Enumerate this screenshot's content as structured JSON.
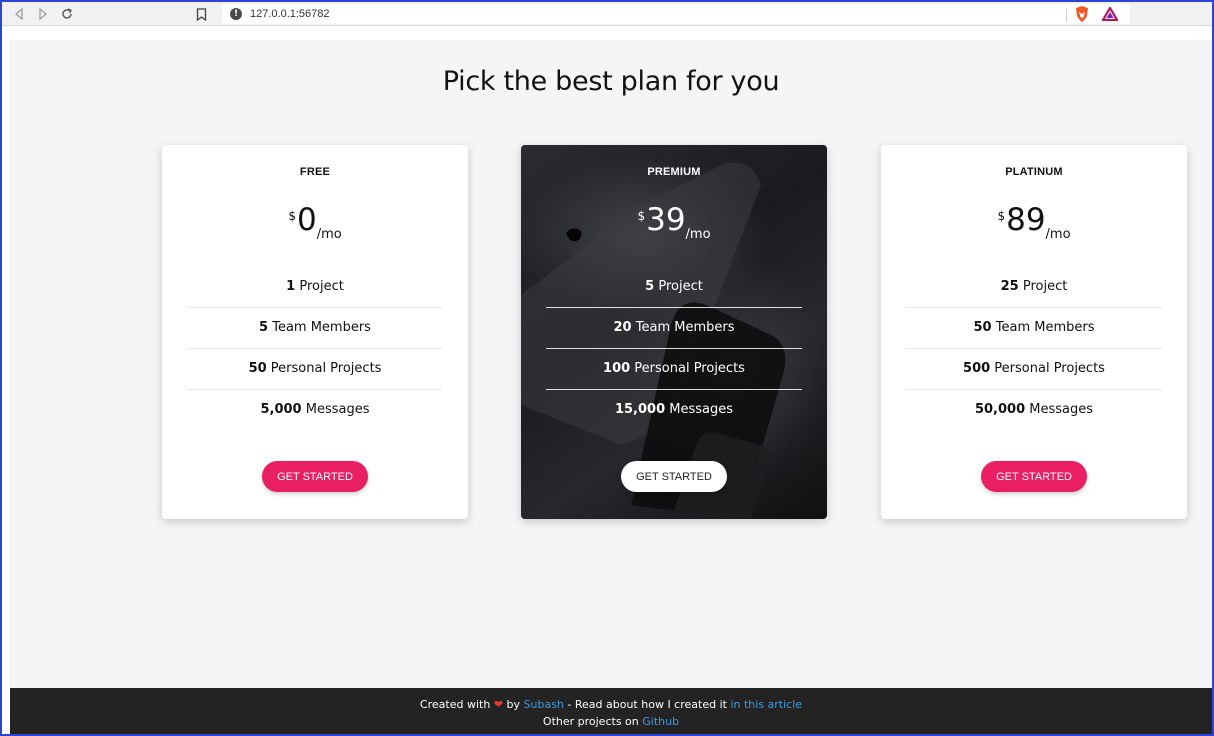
{
  "browser": {
    "url": "127.0.0.1:56782"
  },
  "page": {
    "title": "Pick the best plan for you"
  },
  "plans": [
    {
      "name": "FREE",
      "currency": "$",
      "price": "0",
      "period": "/mo",
      "features": [
        {
          "count": "1",
          "label": " Project"
        },
        {
          "count": "5",
          "label": " Team Members"
        },
        {
          "count": "50",
          "label": " Personal Projects"
        },
        {
          "count": "5,000",
          "label": " Messages"
        }
      ],
      "cta": "GET STARTED"
    },
    {
      "name": "PREMIUM",
      "currency": "$",
      "price": "39",
      "period": "/mo",
      "features": [
        {
          "count": "5",
          "label": " Project"
        },
        {
          "count": "20",
          "label": " Team Members"
        },
        {
          "count": "100",
          "label": " Personal Projects"
        },
        {
          "count": "15,000",
          "label": " Messages"
        }
      ],
      "cta": "GET STARTED"
    },
    {
      "name": "PLATINUM",
      "currency": "$",
      "price": "89",
      "period": "/mo",
      "features": [
        {
          "count": "25",
          "label": " Project"
        },
        {
          "count": "50",
          "label": " Team Members"
        },
        {
          "count": "500",
          "label": " Personal Projects"
        },
        {
          "count": "50,000",
          "label": " Messages"
        }
      ],
      "cta": "GET STARTED"
    }
  ],
  "footer": {
    "created_with": "Created with",
    "by": "by",
    "author": "Subash",
    "read_about": "- Read about how I created it",
    "article_link": "in this article",
    "other_projects": "Other projects on",
    "github_link": "Github"
  },
  "colors": {
    "accent": "#e91e63",
    "link": "#3d9be0",
    "footer_bg": "#232323"
  }
}
